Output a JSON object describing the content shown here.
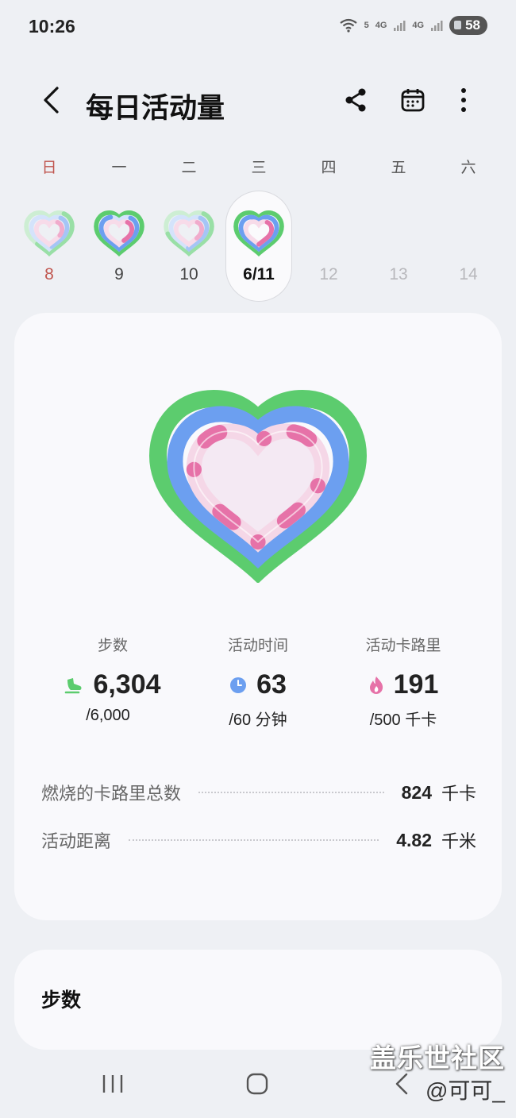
{
  "status_bar": {
    "time": "10:26",
    "net1": "5",
    "net2": "4G",
    "net3": "4G",
    "battery": "58"
  },
  "header": {
    "title": "每日活动量",
    "back_icon": "chevron-left-icon",
    "share_icon": "share-icon",
    "calendar_icon": "calendar-icon",
    "more_icon": "more-vertical-icon"
  },
  "week": {
    "days": [
      "日",
      "一",
      "二",
      "三",
      "四",
      "五",
      "六"
    ],
    "dates": [
      "8",
      "9",
      "10",
      "6/11",
      "12",
      "13",
      "14"
    ],
    "selected_index": 3
  },
  "summary": {
    "steps": {
      "label": "步数",
      "value": "6,304",
      "goal": "/6,000",
      "icon": "shoe-icon",
      "progress": 1.0
    },
    "active_time": {
      "label": "活动时间",
      "value": "63",
      "goal": "/60 分钟",
      "icon": "clock-icon",
      "progress": 1.0
    },
    "calories": {
      "label": "活动卡路里",
      "value": "191",
      "goal": "/500 千卡",
      "icon": "flame-icon",
      "progress": 0.38
    }
  },
  "details": [
    {
      "label": "燃烧的卡路里总数",
      "value": "824",
      "unit": "千卡"
    },
    {
      "label": "活动距离",
      "value": "4.82",
      "unit": "千米"
    }
  ],
  "steps_card": {
    "title": "步数"
  },
  "watermark": {
    "line1": "盖乐世社区",
    "line2": "@可可_"
  },
  "colors": {
    "steps_ring": "#5ccc6e",
    "time_ring": "#6c9ff0",
    "calories_ring": "#e672a8",
    "sunday": "#c0564f"
  }
}
